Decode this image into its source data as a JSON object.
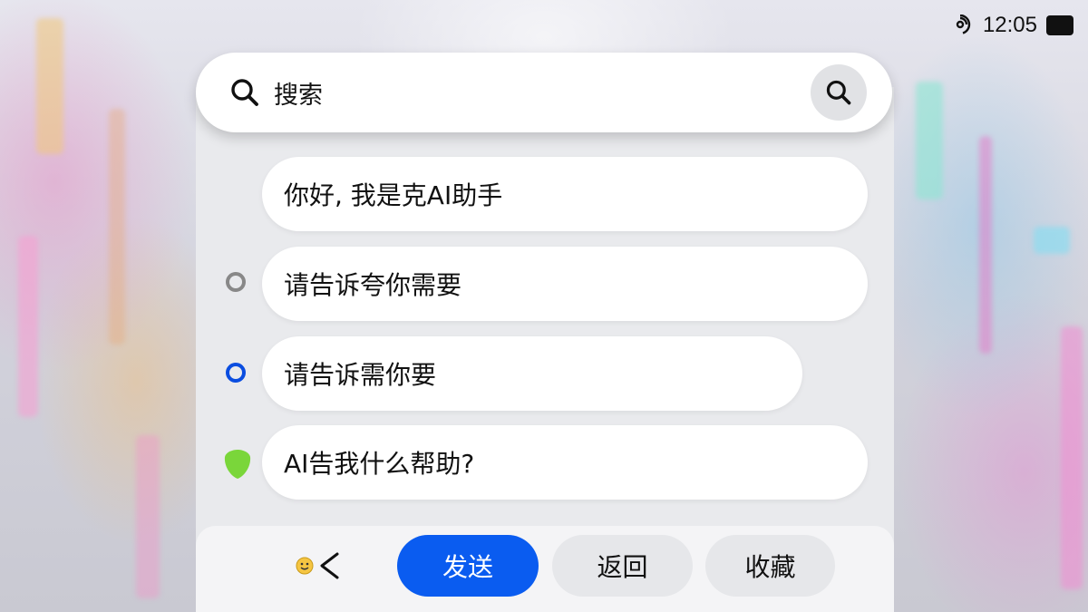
{
  "status_bar": {
    "time": "12:05"
  },
  "search": {
    "placeholder": "搜索"
  },
  "chat": {
    "messages": [
      {
        "text": "你好, 我是克AI助手",
        "marker": "none"
      },
      {
        "text": "请告诉夸你需要",
        "marker": "gray-ring"
      },
      {
        "text": "请告诉需你要",
        "marker": "blue-ring"
      },
      {
        "text": "AI告我什么帮助?",
        "marker": "green-shield"
      }
    ]
  },
  "toolbar": {
    "send_label": "发送",
    "back_label": "返回",
    "favorite_label": "收藏",
    "icons": [
      "smiley-emoji-icon",
      "chevron-left-icon"
    ]
  },
  "colors": {
    "primary": "#0a5cf0",
    "blue_ring": "#0a4de0",
    "gray_ring": "#888888",
    "green_marker": "#7ad63a"
  }
}
